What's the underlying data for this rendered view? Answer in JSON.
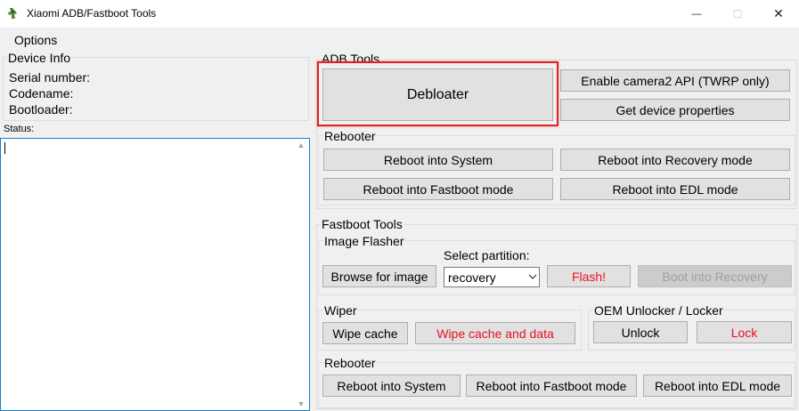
{
  "window": {
    "title": "Xiaomi ADB/Fastboot Tools",
    "minimize_glyph": "—",
    "maximize_glyph": "☐",
    "close_glyph": "✕"
  },
  "menu": {
    "options": "Options"
  },
  "device_info": {
    "label": "Device Info",
    "serial": "Serial number:",
    "codename": "Codename:",
    "bootloader": "Bootloader:"
  },
  "status": {
    "label": "Status:",
    "value": ""
  },
  "adb_tools": {
    "label": "ADB Tools",
    "debloater": "Debloater",
    "camera2": "Enable camera2 API (TWRP only)",
    "device_props": "Get device properties",
    "rebooter": {
      "label": "Rebooter",
      "system": "Reboot into System",
      "recovery": "Reboot into Recovery mode",
      "fastboot": "Reboot into Fastboot mode",
      "edl": "Reboot into EDL mode"
    }
  },
  "fastboot_tools": {
    "label": "Fastboot Tools",
    "image_flasher": {
      "label": "Image Flasher",
      "select_partition_label": "Select partition:",
      "browse": "Browse for image",
      "partition_value": "recovery",
      "flash": "Flash!",
      "boot_recovery": "Boot into Recovery"
    },
    "wiper": {
      "label": "Wiper",
      "wipe_cache": "Wipe cache",
      "wipe_cache_data": "Wipe cache and data"
    },
    "oem": {
      "label": "OEM Unlocker / Locker",
      "unlock": "Unlock",
      "lock": "Lock"
    },
    "rebooter": {
      "label": "Rebooter",
      "system": "Reboot into System",
      "fastboot": "Reboot into Fastboot mode",
      "edl": "Reboot into EDL mode"
    }
  },
  "colors": {
    "accent_red": "#e81123",
    "highlight_border": "#e02020",
    "status_border": "#1a7fc1",
    "button_bg": "#e1e1e1",
    "window_bg": "#f0f0f0"
  }
}
